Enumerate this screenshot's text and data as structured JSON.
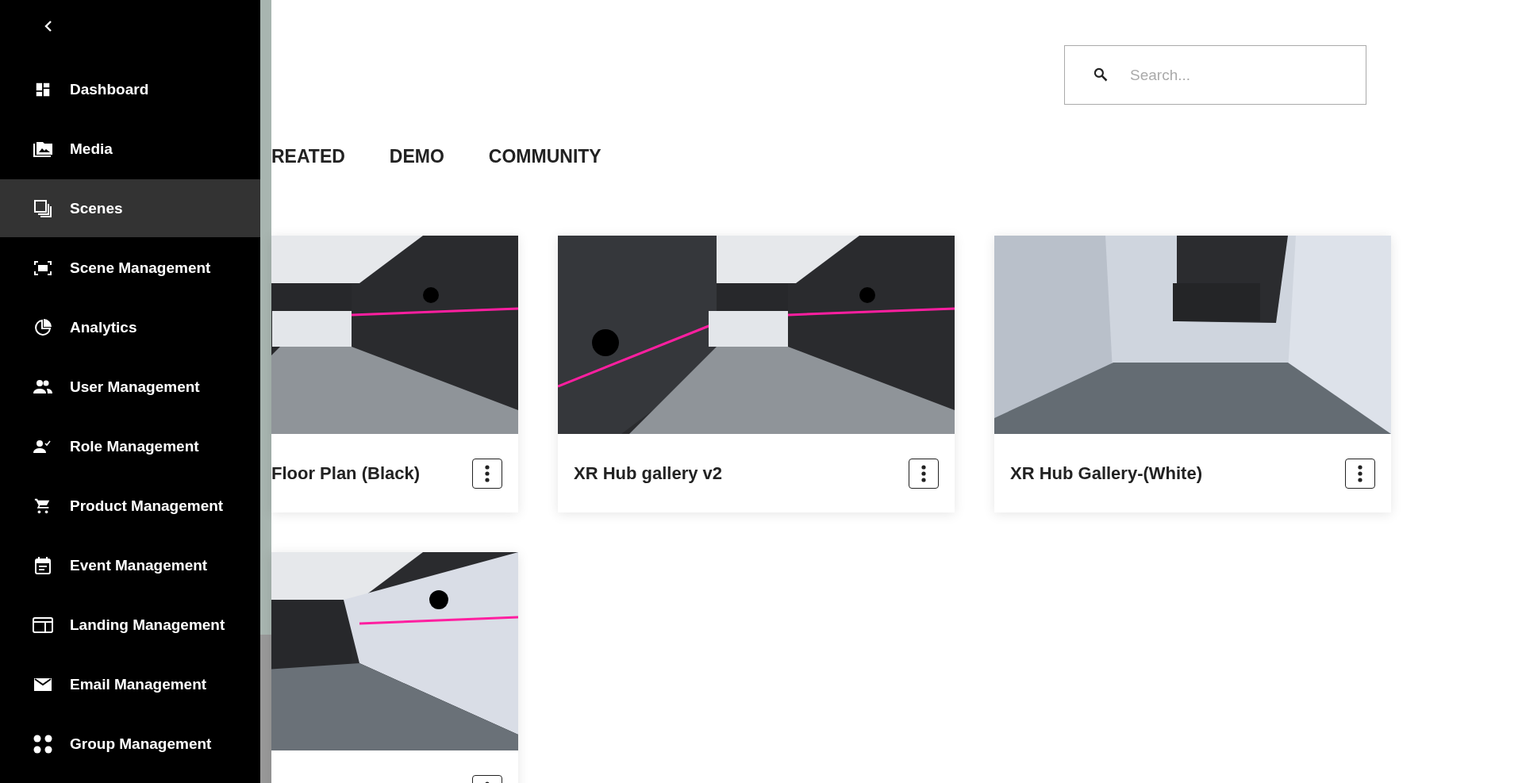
{
  "sidebar": {
    "items": [
      {
        "label": "Dashboard",
        "selected": false
      },
      {
        "label": "Media",
        "selected": false
      },
      {
        "label": "Scenes",
        "selected": true
      },
      {
        "label": "Scene Management",
        "selected": false
      },
      {
        "label": "Analytics",
        "selected": false
      },
      {
        "label": "User Management",
        "selected": false
      },
      {
        "label": "Role Management",
        "selected": false
      },
      {
        "label": "Product Management",
        "selected": false
      },
      {
        "label": "Event Management",
        "selected": false
      },
      {
        "label": "Landing Management",
        "selected": false
      },
      {
        "label": "Email Management",
        "selected": false
      },
      {
        "label": "Group Management",
        "selected": false
      }
    ]
  },
  "search": {
    "placeholder": "Search..."
  },
  "tabs": [
    {
      "label": "REATED"
    },
    {
      "label": "DEMO"
    },
    {
      "label": "COMMUNITY"
    }
  ],
  "cards": [
    {
      "title": "Floor Plan (Black)",
      "picture": {
        "kind": "picture"
      }
    },
    {
      "title": "XR Hub gallery v2",
      "picture": {
        "kind": "picture"
      }
    },
    {
      "title": "XR Hub Gallery-(White)",
      "picture": {
        "kind": "picture"
      }
    },
    {
      "picture": {
        "kind": "picture"
      }
    }
  ]
}
